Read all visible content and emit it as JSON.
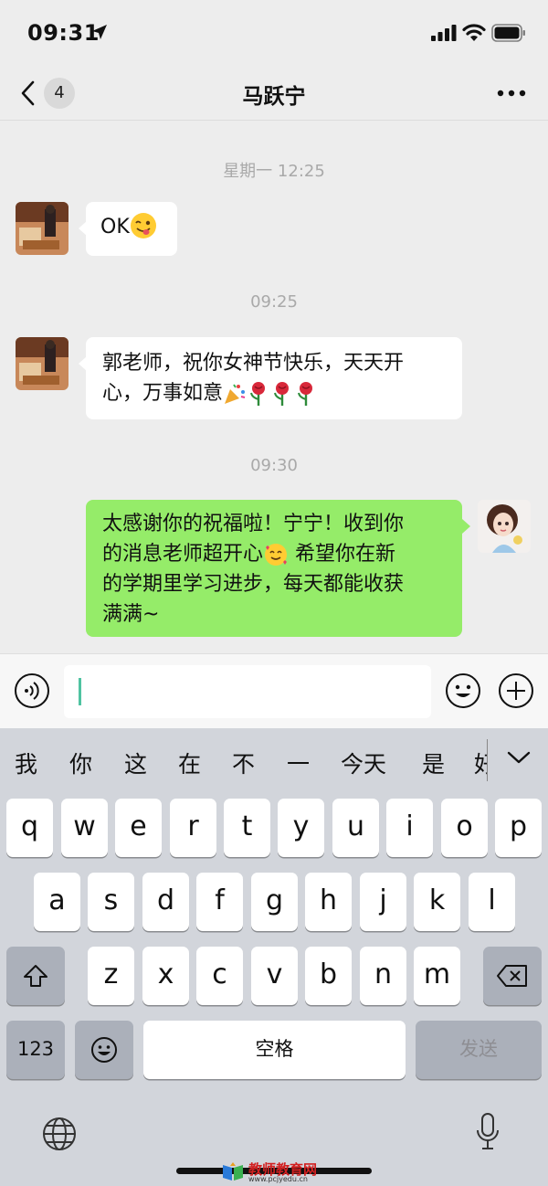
{
  "status_bar": {
    "time": "09:31"
  },
  "nav": {
    "unread_count": "4",
    "title": "马跃宁"
  },
  "chat": {
    "messages": [
      {
        "type": "time",
        "text": "星期一 12:25"
      },
      {
        "type": "incoming",
        "text": "OK"
      },
      {
        "type": "time",
        "text": "09:25"
      },
      {
        "type": "incoming",
        "line1": "郭老师，祝你女神节快乐，天天开",
        "line2": "心，万事如意"
      },
      {
        "type": "time",
        "text": "09:30"
      },
      {
        "type": "outgoing",
        "line1": "太感谢你的祝福啦！宁宁！收到你",
        "line2": "的消息老师超开心",
        "line2b": "希望你在新",
        "line3": "的学期里学习进步，每天都能收获",
        "line4": "满满~"
      }
    ]
  },
  "input": {
    "value": ""
  },
  "keyboard": {
    "candidates": [
      "我",
      "你",
      "这",
      "在",
      "不",
      "一",
      "今天",
      "是",
      "好"
    ],
    "row1": [
      "q",
      "w",
      "e",
      "r",
      "t",
      "y",
      "u",
      "i",
      "o",
      "p"
    ],
    "row2": [
      "a",
      "s",
      "d",
      "f",
      "g",
      "h",
      "j",
      "k",
      "l"
    ],
    "row3": [
      "z",
      "x",
      "c",
      "v",
      "b",
      "n",
      "m"
    ],
    "numbers_label": "123",
    "space_label": "空格",
    "send_label": "发送"
  },
  "watermark": {
    "name": "教师教育网",
    "url": "www.pcjyedu.cn"
  },
  "colors": {
    "outgoing_bubble": "#95ec69",
    "incoming_bubble": "#ffffff",
    "background": "#ededed",
    "keyboard": "#d2d5db"
  }
}
